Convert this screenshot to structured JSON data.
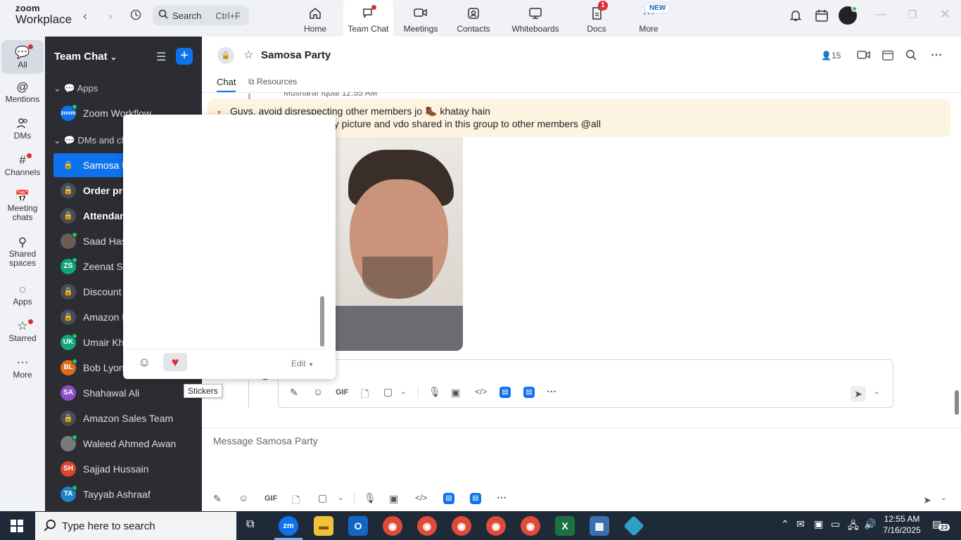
{
  "app": {
    "brand_top": "zoom",
    "brand_bottom": "Workplace"
  },
  "topbar": {
    "search_label": "Search",
    "search_shortcut": "Ctrl+F",
    "tabs": [
      {
        "label": "Home",
        "icon": "home-icon"
      },
      {
        "label": "Team Chat",
        "icon": "chat-icon"
      },
      {
        "label": "Meetings",
        "icon": "video-icon"
      },
      {
        "label": "Contacts",
        "icon": "contacts-icon"
      },
      {
        "label": "Whiteboards",
        "icon": "whiteboard-icon"
      },
      {
        "label": "Docs",
        "icon": "docs-icon",
        "badge": "1"
      },
      {
        "label": "More",
        "icon": "more-icon",
        "badge": "NEW"
      }
    ],
    "active_tab": "Team Chat"
  },
  "rail": {
    "items": [
      {
        "label": "All",
        "icon": "chat-bubble-icon"
      },
      {
        "label": "Mentions",
        "icon": "at-icon"
      },
      {
        "label": "DMs",
        "icon": "people-icon"
      },
      {
        "label": "Channels",
        "icon": "hash-icon"
      },
      {
        "label_line1": "Meeting",
        "label_line2": "chats",
        "icon": "calendar-icon"
      },
      {
        "label_line1": "Shared",
        "label_line2": "spaces",
        "icon": "share-icon"
      },
      {
        "label": "Apps",
        "icon": "apps-icon"
      },
      {
        "label": "Starred",
        "icon": "star-icon"
      },
      {
        "label": "More",
        "icon": "more-icon"
      }
    ]
  },
  "chatlist": {
    "title": "Team Chat",
    "sections": {
      "apps": "Apps",
      "dms": "DMs and ch"
    },
    "rows": [
      {
        "name": "Zoom Workflow",
        "avatar": "zoom",
        "color": "#0e72ed"
      },
      {
        "name": "Samosa P",
        "avatar": "lock"
      },
      {
        "name": "Order pro",
        "avatar": "lock",
        "bold": true
      },
      {
        "name": "Attendan",
        "avatar": "lock",
        "bold": true
      },
      {
        "name": "Saad Has",
        "avatar": "photo",
        "color": "#6b5d4f"
      },
      {
        "name": "Zeenat Sic",
        "avatar": "ZS",
        "color": "#13a57a"
      },
      {
        "name": "Discount",
        "avatar": "lock"
      },
      {
        "name": "Amazon P",
        "avatar": "lock"
      },
      {
        "name": "Umair Kha",
        "avatar": "UK",
        "color": "#13a57a"
      },
      {
        "name": "Bob Lyon",
        "avatar": "BL",
        "color": "#e0691a"
      },
      {
        "name": "Shahawal Ali",
        "avatar": "SA",
        "color": "#8e4fc4"
      },
      {
        "name": "Amazon Sales Team",
        "avatar": "lock"
      },
      {
        "name": "Waleed Ahmed Awan",
        "avatar": "photo",
        "color": "#7a7a7a"
      },
      {
        "name": "Sajjad Hussain",
        "avatar": "SH",
        "color": "#e0442b"
      },
      {
        "name": "Tayyab Ashraaf",
        "avatar": "TA",
        "color": "#1a84c9"
      }
    ]
  },
  "chat": {
    "title": "Samosa Party",
    "member_count": "15",
    "tabs": [
      "Chat",
      "Resources"
    ],
    "partial_sender": "Musharaf Iqbal 12:55 AM",
    "banner_line1": "Guys, avoid disrespecting other members jo 🥾 khatay hain",
    "banner_line2": "ny picture and vdo shared in this group to other members @all",
    "message_placeholder": "Message Samosa Party",
    "gif_label": "GIF"
  },
  "popup": {
    "edit_label": "Edit",
    "tooltip": "Stickers"
  },
  "taskbar": {
    "search_placeholder": "Type here to search",
    "time": "12:55 AM",
    "date": "7/16/2025",
    "notifications": "23"
  }
}
